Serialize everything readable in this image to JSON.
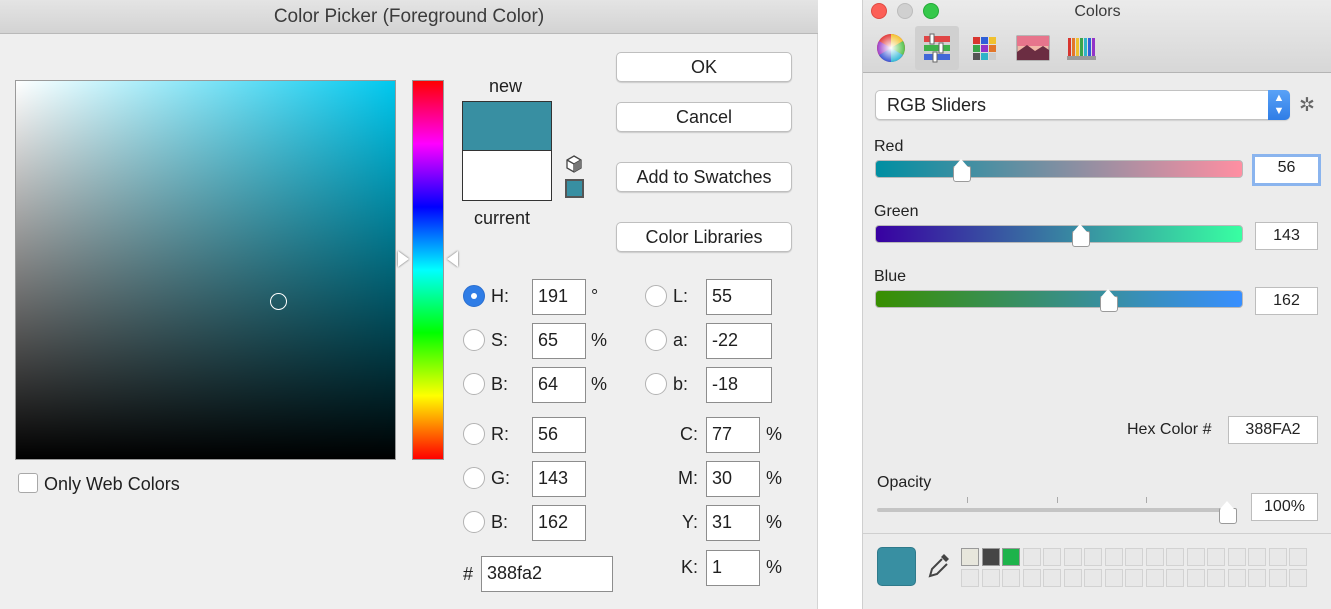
{
  "photoshop": {
    "title": "Color Picker (Foreground Color)",
    "new_label": "new",
    "current_label": "current",
    "new_color": "#388fa2",
    "current_color": "#ffffff",
    "buttons": {
      "ok": "OK",
      "cancel": "Cancel",
      "add_to_swatches": "Add to Swatches",
      "color_libraries": "Color Libraries"
    },
    "only_web_colors": "Only Web Colors",
    "hsb": [
      {
        "label": "H:",
        "value": "191",
        "unit": "°",
        "selected": true
      },
      {
        "label": "S:",
        "value": "65",
        "unit": "%",
        "selected": false
      },
      {
        "label": "B:",
        "value": "64",
        "unit": "%",
        "selected": false
      }
    ],
    "rgb": [
      {
        "label": "R:",
        "value": "56"
      },
      {
        "label": "G:",
        "value": "143"
      },
      {
        "label": "B:",
        "value": "162"
      }
    ],
    "lab": [
      {
        "label": "L:",
        "value": "55"
      },
      {
        "label": "a:",
        "value": "-22"
      },
      {
        "label": "b:",
        "value": "-18"
      }
    ],
    "cmyk": [
      {
        "label": "C:",
        "value": "77",
        "unit": "%"
      },
      {
        "label": "M:",
        "value": "30",
        "unit": "%"
      },
      {
        "label": "Y:",
        "value": "31",
        "unit": "%"
      },
      {
        "label": "K:",
        "value": "1",
        "unit": "%"
      }
    ],
    "hex_label": "#",
    "hex_value": "388fa2"
  },
  "mac": {
    "title": "Colors",
    "toolbar": [
      "color-wheel-icon",
      "color-sliders-icon",
      "color-palettes-icon",
      "image-palettes-icon",
      "pencils-icon"
    ],
    "mode": "RGB Sliders",
    "sliders": [
      {
        "label": "Red",
        "value": "56",
        "level": 0.22
      },
      {
        "label": "Green",
        "value": "143",
        "level": 0.56
      },
      {
        "label": "Blue",
        "value": "162",
        "level": 0.64
      }
    ],
    "hex_label": "Hex Color #",
    "hex_value": "388FA2",
    "opacity_label": "Opacity",
    "opacity_value": "100%",
    "opacity_level": 1.0,
    "current_color": "#388fa2",
    "saved_swatches": [
      "#e7e6dc",
      "#454545",
      "#1db34b"
    ]
  }
}
